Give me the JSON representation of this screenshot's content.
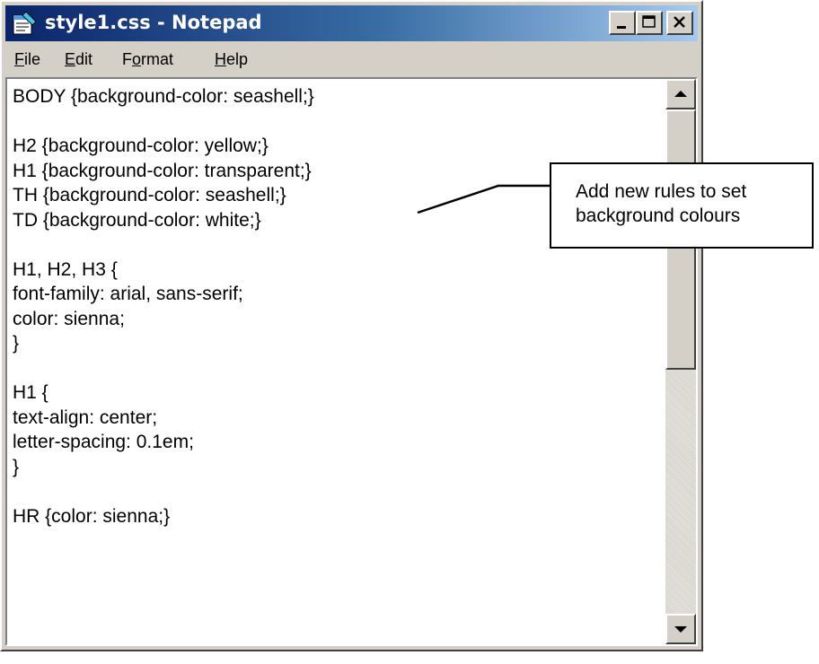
{
  "window": {
    "title": "style1.css - Notepad"
  },
  "menu": {
    "file": {
      "mnemonic": "F",
      "rest": "ile"
    },
    "edit": {
      "mnemonic": "E",
      "rest": "dit"
    },
    "format": {
      "pre": "F",
      "mnemonic": "o",
      "rest": "rmat"
    },
    "help": {
      "mnemonic": "H",
      "rest": "elp"
    }
  },
  "editor": {
    "content": "BODY {background-color: seashell;}\n\nH2 {background-color: yellow;}\nH1 {background-color: transparent;}\nTH {background-color: seashell;}\nTD {background-color: white;}\n\nH1, H2, H3 {\nfont-family: arial, sans-serif;\ncolor: sienna;\n}\n\nH1 {\ntext-align: center;\nletter-spacing: 0.1em;\n}\n\nHR {color: sienna;}"
  },
  "callout": {
    "line1": "Add new rules to set",
    "line2": "background colours"
  },
  "icons": {
    "app": "notepad-icon",
    "minimize": "minimize-icon",
    "maximize": "maximize-icon",
    "close": "close-icon",
    "scroll_up": "arrow-up-icon",
    "scroll_down": "arrow-down-icon"
  },
  "colors": {
    "titlebar_start": "#0a246a",
    "titlebar_end": "#a6caf0",
    "chrome": "#d4d0c8"
  }
}
